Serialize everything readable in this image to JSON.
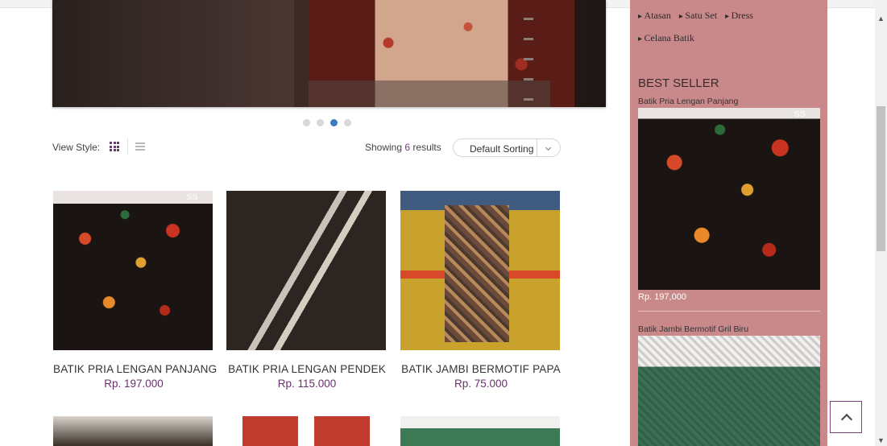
{
  "hero": {
    "dots": 4,
    "active_dot": 2
  },
  "toolbar": {
    "view_style_label": "View Style:",
    "showing_prefix": "Showing",
    "showing_count": "6",
    "showing_suffix": "results",
    "sort_label": "Default Sorting"
  },
  "products": [
    {
      "name": "BATIK PRIA LENGAN PANJANG",
      "price": "Rp. 197.000",
      "badge": "SS",
      "icon": "shirt-long-sleeve"
    },
    {
      "name": "BATIK PRIA LENGAN PENDEK",
      "price": "Rp. 115.000",
      "icon": "shirt-short-sleeve"
    },
    {
      "name": "BATIK JAMBI BERMOTIF PAPA",
      "price": "Rp. 75.000",
      "icon": "batik-pants"
    }
  ],
  "sidebar": {
    "categories_row1": [
      "Atasan",
      "Satu Set",
      "Dress"
    ],
    "categories_row2": [
      "Celana Batik"
    ],
    "best_seller_title": "BEST SELLER",
    "items": [
      {
        "title": "Batik Pria Lengan Panjang",
        "price": "Rp. 197,000",
        "badge": "SS"
      },
      {
        "title": "Batik Jambi Bermotif Gril Biru"
      }
    ]
  },
  "colors": {
    "accent": "#6a2f6e",
    "sidebar_bg": "#c9898a",
    "active_dot": "#3a7bbf"
  }
}
